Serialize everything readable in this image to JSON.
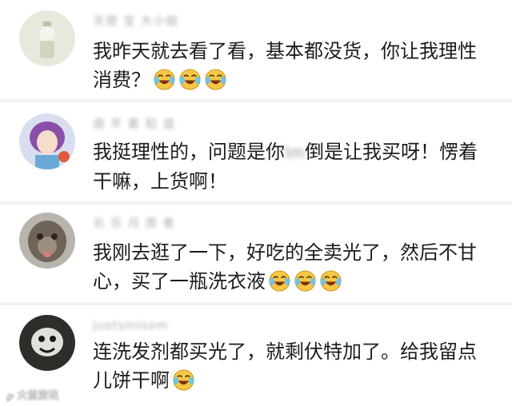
{
  "comments": [
    {
      "username": "天使 宝 大小姐",
      "text": "我昨天就去看了看，基本都没货，你让我理性消费？",
      "emoji_count": 3,
      "emoji_icon": "laughing-crying-emoji"
    },
    {
      "username": "南 平 素 和 道",
      "text_before": "我挺理性的，问题是你",
      "blurred_word": "lm",
      "text_after": "倒是让我买呀！愣着干嘛，上货啊！"
    },
    {
      "username": "长 乐 月 南 者",
      "text": "我刚去逛了一下，好吃的全卖光了，然后不甘心，买了一瓶洗衣液",
      "emoji_count": 3,
      "emoji_icon": "laughing-crying-emoji"
    },
    {
      "username": "justsmissm",
      "text": "连洗发剂都买光了，就剩伏特加了。给我留点儿饼干啊",
      "emoji_count": 1,
      "emoji_icon": "laughing-crying-emoji"
    }
  ],
  "watermark": "大鼠资讯",
  "colors": {
    "background": "#f2f2f2",
    "card": "#ffffff",
    "text": "#1c1c1c",
    "username": "#b0b0b0",
    "emoji_face": "#f6c744"
  }
}
